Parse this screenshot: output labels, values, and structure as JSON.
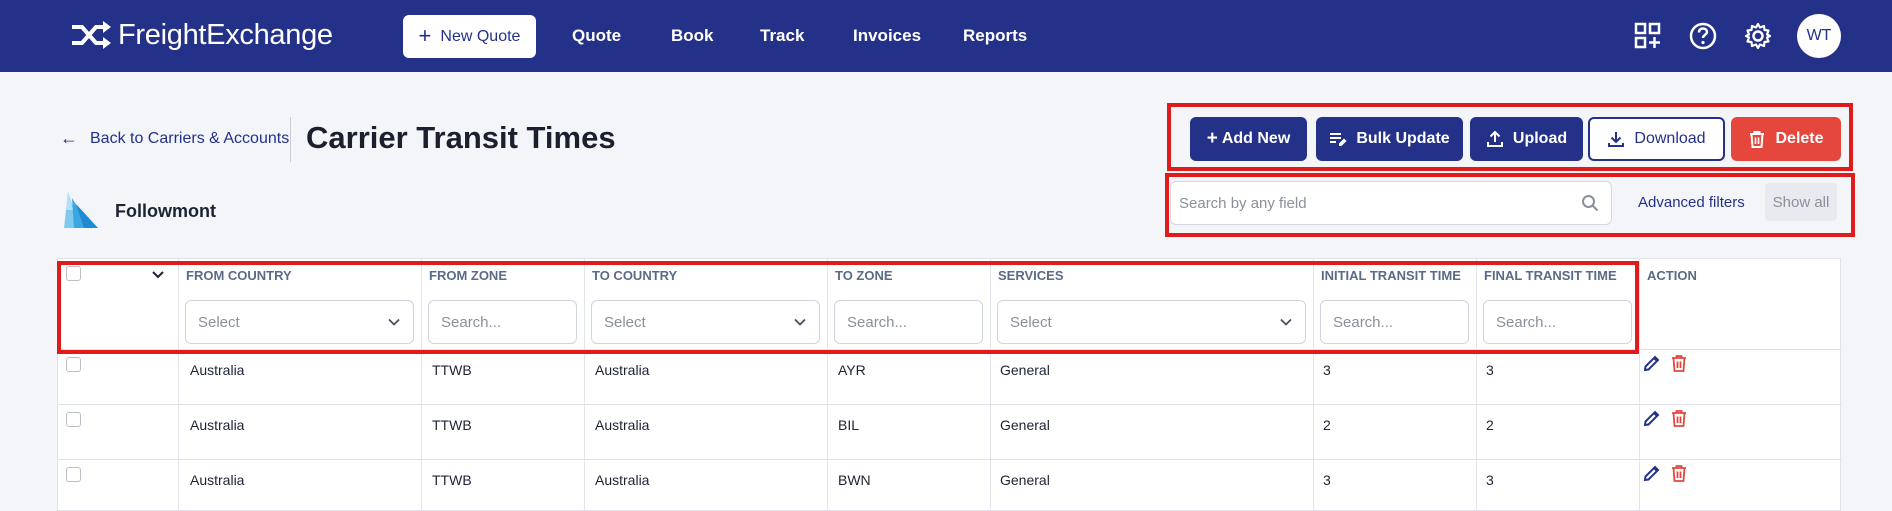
{
  "header": {
    "brand": "FreightExchange",
    "new_quote_label": "New Quote",
    "nav": [
      "Quote",
      "Book",
      "Track",
      "Invoices",
      "Reports"
    ],
    "icons": [
      "apps-add-icon",
      "help-icon",
      "settings-icon"
    ],
    "avatar_initials": "WT"
  },
  "page": {
    "back_label": "Back to Carriers & Accounts",
    "title": "Carrier Transit Times",
    "carrier_name": "Followmont"
  },
  "actions": {
    "add_new": "Add New",
    "bulk_update": "Bulk Update",
    "upload": "Upload",
    "download": "Download",
    "delete": "Delete"
  },
  "search": {
    "placeholder": "Search by any field",
    "advanced_filters": "Advanced filters",
    "show_all": "Show all"
  },
  "table": {
    "columns": [
      "FROM COUNTRY",
      "FROM ZONE",
      "TO COUNTRY",
      "TO ZONE",
      "SERVICES",
      "INITIAL TRANSIT TIME",
      "FINAL TRANSIT TIME",
      "ACTION"
    ],
    "filters": {
      "from_country": "Select",
      "from_zone": "Search...",
      "to_country": "Select",
      "to_zone": "Search...",
      "services": "Select",
      "initial_transit": "Search...",
      "final_transit": "Search..."
    },
    "rows": [
      {
        "from_country": "Australia",
        "from_zone": "TTWB",
        "to_country": "Australia",
        "to_zone": "AYR",
        "services": "General",
        "initial": "3",
        "final": "3"
      },
      {
        "from_country": "Australia",
        "from_zone": "TTWB",
        "to_country": "Australia",
        "to_zone": "BIL",
        "services": "General",
        "initial": "2",
        "final": "2"
      },
      {
        "from_country": "Australia",
        "from_zone": "TTWB",
        "to_country": "Australia",
        "to_zone": "BWN",
        "services": "General",
        "initial": "3",
        "final": "3"
      }
    ]
  },
  "colors": {
    "brand_navy": "#243189",
    "danger_red": "#e5473d",
    "highlight_red": "#e01b1b"
  }
}
